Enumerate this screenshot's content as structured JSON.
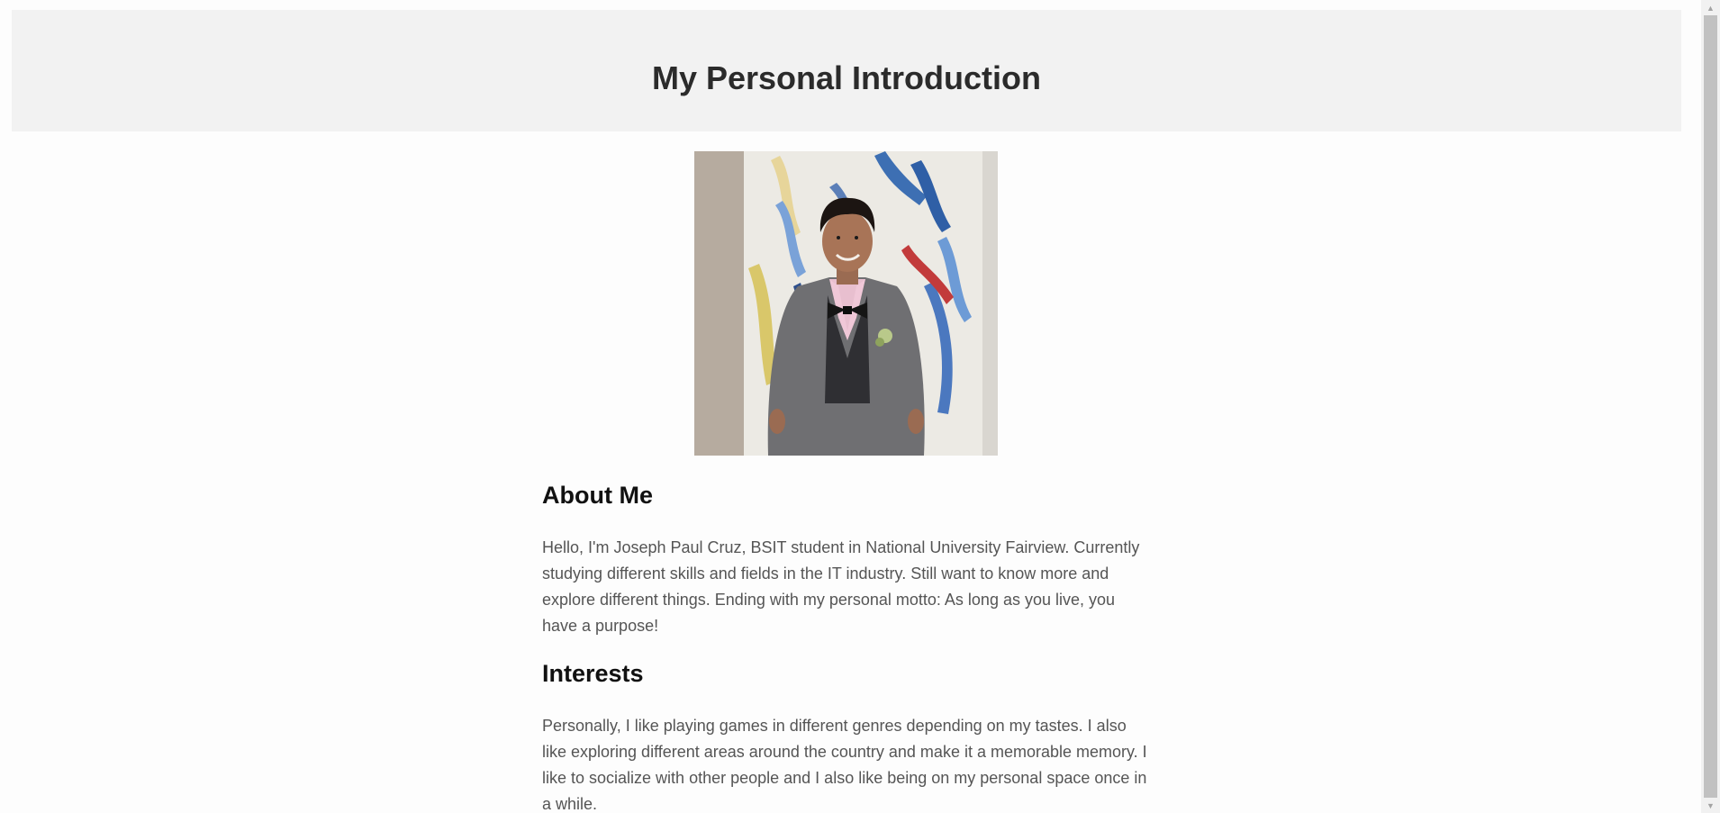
{
  "header": {
    "title": "My Personal Introduction"
  },
  "photo": {
    "alt": "Portrait photo in grey suit with pink shirt and black bow tie"
  },
  "about": {
    "heading": "About Me",
    "text": "Hello, I'm Joseph Paul Cruz, BSIT student in National University Fairview. Currently studying different skills and fields in the IT industry. Still want to know more and explore different things. Ending with my personal motto: As long as you live, you have a purpose!"
  },
  "interests": {
    "heading": "Interests",
    "text": "Personally, I like playing games in different genres depending on my tastes. I also like exploring different areas around the country and make it a memorable memory. I like to socialize with other people and I also like being on my personal space once in a while."
  },
  "scrollbar": {
    "up_icon": "arrow-up-icon",
    "down_icon": "arrow-down-icon"
  }
}
